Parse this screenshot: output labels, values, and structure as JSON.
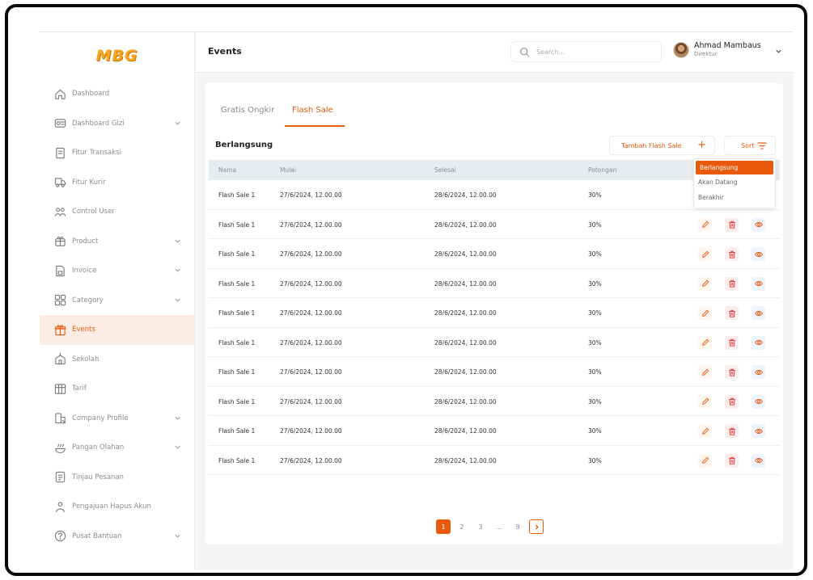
{
  "brand": {
    "logo": "MBG",
    "accent": "#e8590c",
    "logo_color": "#f5a623"
  },
  "header": {
    "title": "Events",
    "search_placeholder": "Search...",
    "user_name": "Ahmad Mambaus",
    "user_role": "Direktur"
  },
  "sidebar": {
    "items": [
      {
        "label": "Dashboard",
        "icon": "home-icon"
      },
      {
        "label": "Dashboard Gizi",
        "icon": "nutrition-icon",
        "chevron": true
      },
      {
        "label": "Fitur Transaksi",
        "icon": "receipt-icon"
      },
      {
        "label": "Fitur Kurir",
        "icon": "truck-icon"
      },
      {
        "label": "Control User",
        "icon": "users-icon"
      },
      {
        "label": "Product",
        "icon": "box-icon",
        "chevron": true
      },
      {
        "label": "Invoice",
        "icon": "invoice-icon",
        "chevron": true
      },
      {
        "label": "Category",
        "icon": "category-icon",
        "chevron": true
      },
      {
        "label": "Events",
        "icon": "gift-icon",
        "active": true
      },
      {
        "label": "Sekolah",
        "icon": "school-icon"
      },
      {
        "label": "Tarif",
        "icon": "tariff-icon"
      },
      {
        "label": "Company Profile",
        "icon": "company-icon",
        "chevron": true
      },
      {
        "label": "Pangan Olahan",
        "icon": "food-icon",
        "chevron": true
      },
      {
        "label": "Tinjau Pesanan",
        "icon": "order-review-icon"
      },
      {
        "label": "Pengajuan Hapus Akun",
        "icon": "delete-account-icon"
      },
      {
        "label": "Pusat Bantuan",
        "icon": "help-icon",
        "chevron": true
      }
    ]
  },
  "tabs": [
    {
      "label": "Gratis Ongkir",
      "active": false
    },
    {
      "label": "Flash Sale",
      "active": true
    }
  ],
  "section": {
    "title": "Berlangsung",
    "add_button": "Tambah Flash Sale",
    "sort_button": "Sort"
  },
  "sort_menu": {
    "options": [
      "Berlangsung",
      "Akan Datang",
      "Berakhir"
    ],
    "selected": "Berlangsung"
  },
  "table": {
    "columns": [
      "Nama",
      "Mulai",
      "Selesai",
      "Potongan"
    ],
    "rows": [
      [
        "Flash Sale 1",
        "27/6/2024, 12.00.00",
        "28/6/2024, 12.00.00",
        "30%"
      ],
      [
        "Flash Sale 1",
        "27/6/2024, 12.00.00",
        "28/6/2024, 12.00.00",
        "30%"
      ],
      [
        "Flash Sale 1",
        "27/6/2024, 12.00.00",
        "28/6/2024, 12.00.00",
        "30%"
      ],
      [
        "Flash Sale 1",
        "27/6/2024, 12.00.00",
        "28/6/2024, 12.00.00",
        "30%"
      ],
      [
        "Flash Sale 1",
        "27/6/2024, 12.00.00",
        "28/6/2024, 12.00.00",
        "30%"
      ],
      [
        "Flash Sale 1",
        "27/6/2024, 12.00.00",
        "28/6/2024, 12.00.00",
        "30%"
      ],
      [
        "Flash Sale 1",
        "27/6/2024, 12.00.00",
        "28/6/2024, 12.00.00",
        "30%"
      ],
      [
        "Flash Sale 1",
        "27/6/2024, 12.00.00",
        "28/6/2024, 12.00.00",
        "30%"
      ],
      [
        "Flash Sale 1",
        "27/6/2024, 12.00.00",
        "28/6/2024, 12.00.00",
        "30%"
      ],
      [
        "Flash Sale 1",
        "27/6/2024, 12.00.00",
        "28/6/2024, 12.00.00",
        "30%"
      ]
    ]
  },
  "pagination": {
    "pages": [
      "1",
      "2",
      "3",
      "...",
      "9"
    ],
    "current": "1"
  }
}
